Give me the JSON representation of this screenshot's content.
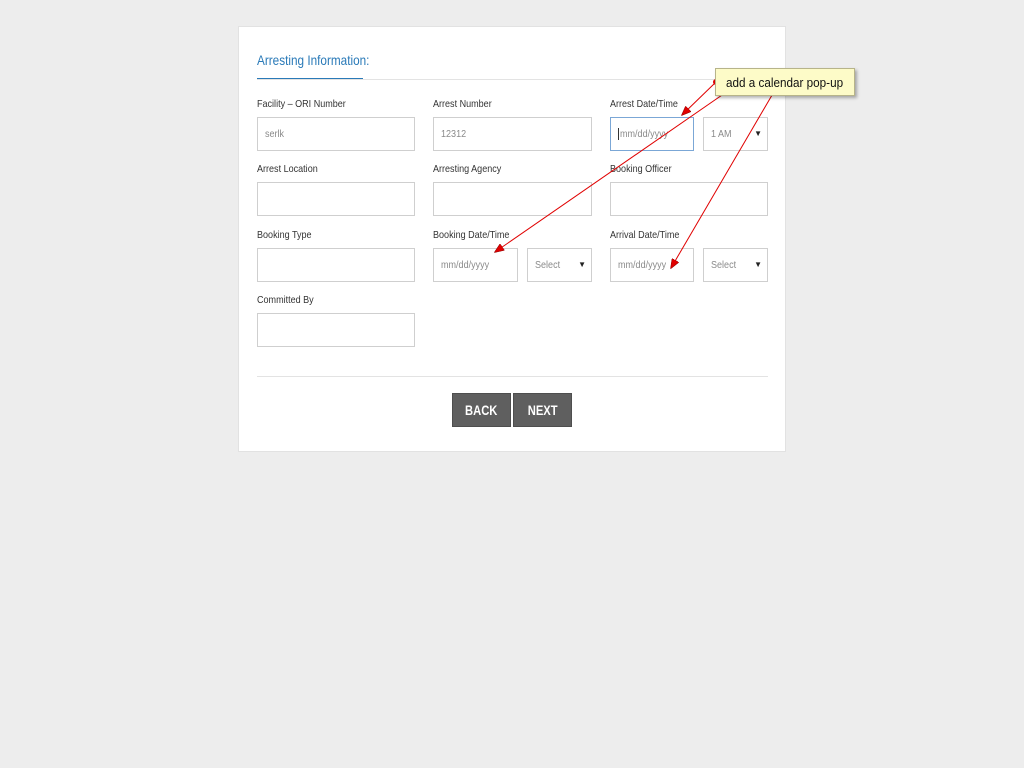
{
  "section": {
    "title": "Arresting Information:"
  },
  "fields": {
    "facility_label": "Facility – ORI Number",
    "facility_value": "serlk",
    "arrest_number_label": "Arrest Number",
    "arrest_number_value": "12312",
    "arrest_datetime_label": "Arrest Date/Time",
    "arrest_date_placeholder": "mm/dd/yyyy",
    "arrest_time_value": "1 AM",
    "arrest_location_label": "Arrest Location",
    "arresting_agency_label": "Arresting Agency",
    "booking_officer_label": "Booking Officer",
    "booking_type_label": "Booking Type",
    "booking_datetime_label": "Booking Date/Time",
    "booking_date_placeholder": "mm/dd/yyyy",
    "booking_time_value": "Select",
    "arrival_datetime_label": "Arrival Date/Time",
    "arrival_date_placeholder": "mm/dd/yyyy",
    "arrival_time_value": "Select",
    "committed_by_label": "Committed By"
  },
  "buttons": {
    "back": "BACK",
    "next": "NEXT"
  },
  "annotation": {
    "text": "add a calendar pop-up",
    "color": "#e00000"
  },
  "colors": {
    "accent": "#2a7ab8",
    "button": "#5f5f5f",
    "note_bg": "#fdfbc8"
  }
}
